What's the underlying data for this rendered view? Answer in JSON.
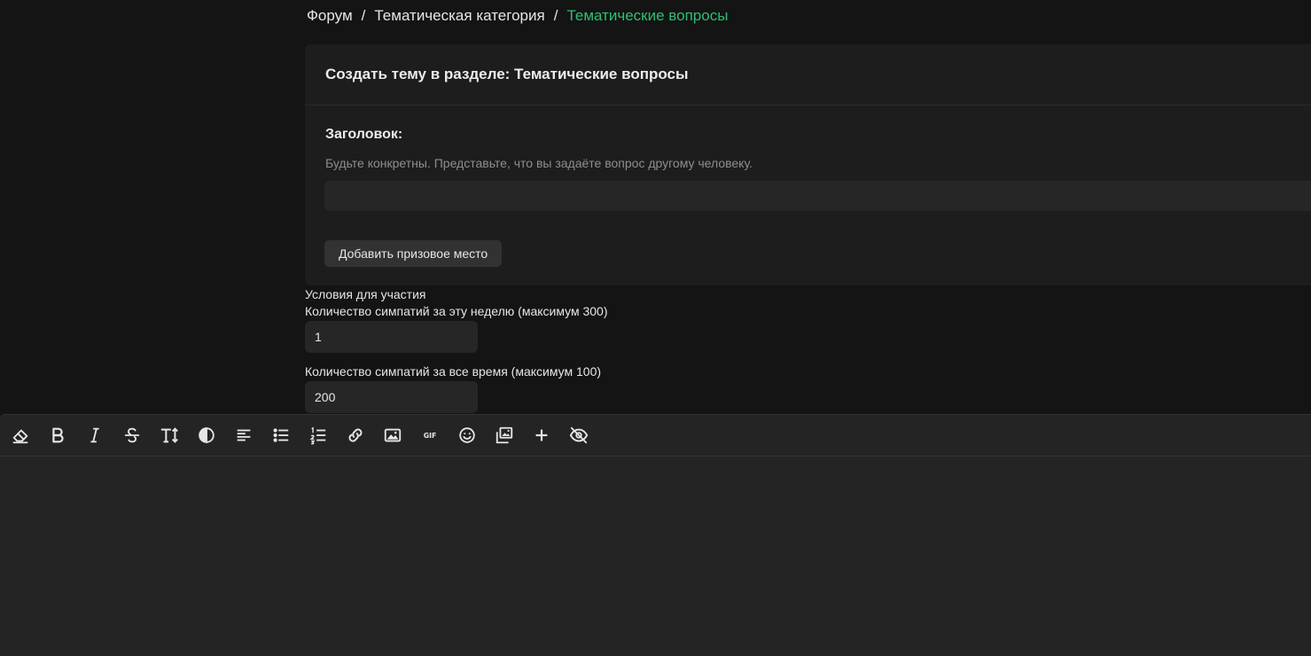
{
  "breadcrumb": {
    "items": [
      "Форум",
      "Тематическая категория",
      "Тематические вопросы"
    ],
    "separator": "/"
  },
  "card": {
    "header": "Создать тему в разделе: Тематические вопросы",
    "title_label": "Заголовок:",
    "title_hint": "Будьте конкретны. Представьте, что вы задаёте вопрос другому человеку.",
    "title_value": "",
    "prize_button": "Добавить призовое место"
  },
  "conditions": {
    "title": "Условия для участия",
    "weekly_label": "Количество симпатий за эту неделю (максимум 300)",
    "weekly_value": "1",
    "alltime_label": "Количество симпатий за все время (максимум 100)",
    "alltime_value": "200"
  },
  "toolbar": {
    "tools": [
      "eraser-icon",
      "bold-icon",
      "italic-icon",
      "strikethrough-icon",
      "text-size-icon",
      "color-icon",
      "align-left-icon",
      "bullet-list-icon",
      "numbered-list-icon",
      "link-icon",
      "image-icon",
      "gif-icon",
      "emoji-icon",
      "media-gallery-icon",
      "insert-plus-icon",
      "hide-content-icon"
    ],
    "gif_label": "GIF"
  },
  "colors": {
    "accent": "#2fbf74",
    "background": "#141414",
    "card": "#1d1d1d",
    "input": "#262626"
  }
}
